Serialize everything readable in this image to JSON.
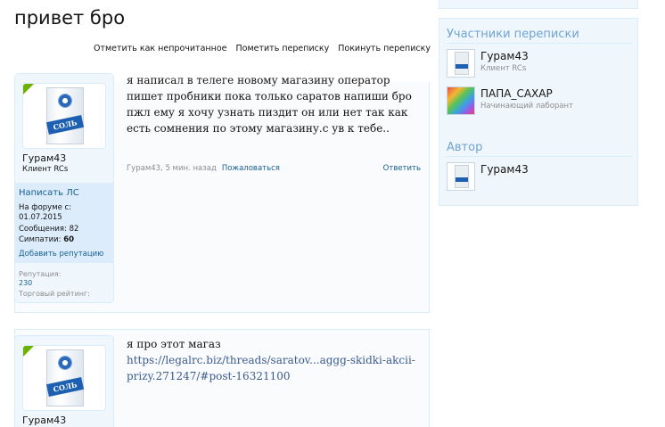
{
  "page": {
    "title": "привет бро"
  },
  "actions": {
    "mark_unread": "Отметить как непрочитанное",
    "tag": "Пометить переписку",
    "leave": "Покинуть переписку"
  },
  "messages": [
    {
      "author": "Гурам43",
      "author_title": "Клиент RCs",
      "pm_label": "Написать ЛС",
      "joined_label": "На форуме с:",
      "joined_value": "01.07.2015",
      "messages_label": "Сообщения:",
      "messages_value": "82",
      "likes_label": "Симпатии:",
      "likes_value": "60",
      "add_rep": "Добавить репутацию",
      "rep_label": "Репутация:",
      "rep_value": "230",
      "trade_label": "Торговый рейтинг:",
      "text": "я написал в телеге новому магазину оператор пишет пробники пока только саратов напиши бро пжл ему я хочу узнать пиздит он или нет так как есть сомнения по этому магазину.с ув к тебе..",
      "meta": "Гурам43, 5 мин. назад",
      "report": "Пожаловаться",
      "reply": "Ответить"
    },
    {
      "author": "Гурам43",
      "text_line": "я про этот магаз",
      "link": "https://legalrc.biz/threads/saratov...aggg-skidki-akcii-prizy.271247/#post-16321100"
    }
  ],
  "sidebar": {
    "participants_title": "Участники переписки",
    "participants": [
      {
        "name": "Гурам43",
        "role": "Клиент RCs"
      },
      {
        "name": "ПАПА_САХАР",
        "role": "Начинающий лаборант"
      }
    ],
    "author_title": "Автор",
    "author": {
      "name": "Гурам43"
    }
  }
}
